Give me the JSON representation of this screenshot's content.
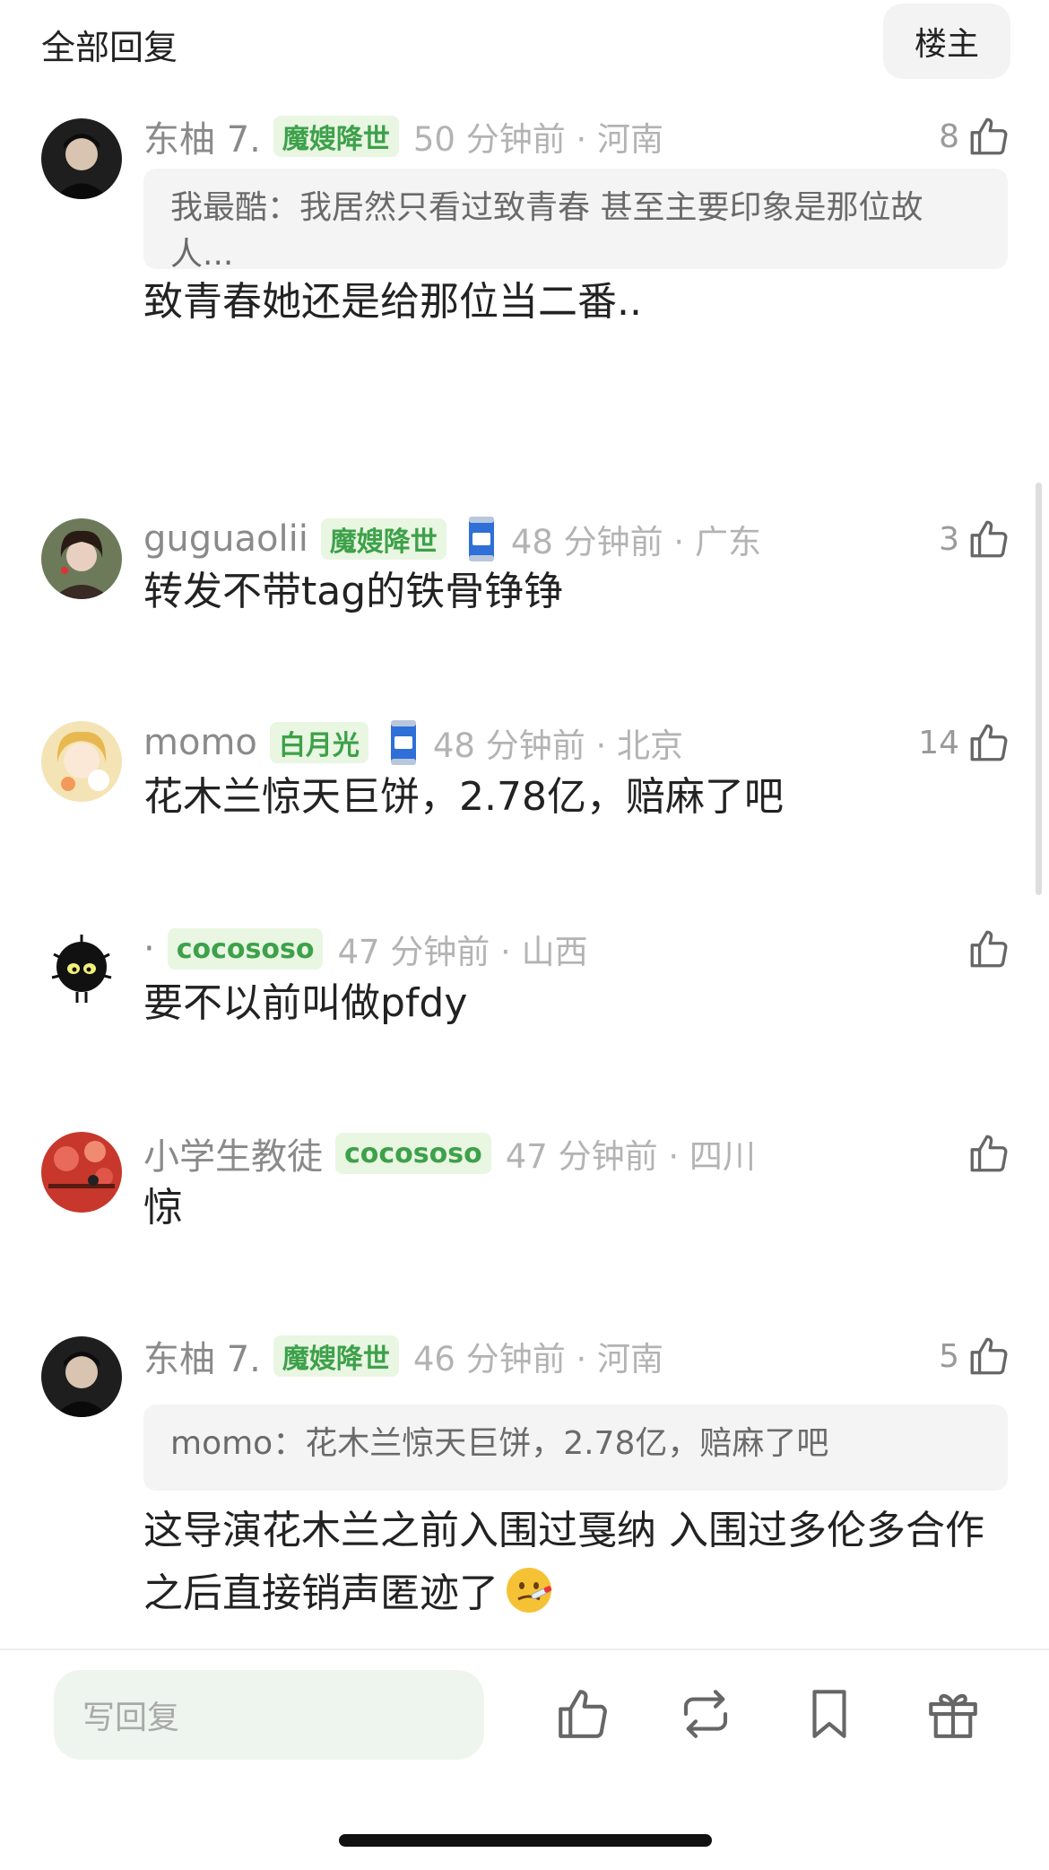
{
  "header": {
    "title": "全部回复",
    "op_button": "楼主"
  },
  "comments": [
    {
      "name": "东柚 7.",
      "badge": "魔嫂降世",
      "has_can": false,
      "time": "50 分钟前 · 河南",
      "likes": "8",
      "quote": "我最酷：我居然只看过致青春 甚至主要印象是那位故人...",
      "text": "致青春她还是给那位当二番.."
    },
    {
      "name": "guguaolii",
      "badge": "魔嫂降世",
      "has_can": true,
      "time": "48 分钟前 · 广东",
      "likes": "3",
      "quote": "",
      "text": "转发不带tag的铁骨铮铮"
    },
    {
      "name": "momo",
      "badge": "白月光",
      "has_can": true,
      "time": "48 分钟前 · 北京",
      "likes": "14",
      "quote": "",
      "text": "花木兰惊天巨饼，2.78亿，赔麻了吧"
    },
    {
      "name": "·",
      "badge": "cocososo",
      "has_can": false,
      "time": "47 分钟前 · 山西",
      "likes": "",
      "quote": "",
      "text": "要不以前叫做pfdy"
    },
    {
      "name": "小学生教徒",
      "badge": "cocososo",
      "has_can": false,
      "time": "47 分钟前 · 四川",
      "likes": "",
      "quote": "",
      "text": "惊"
    },
    {
      "name": "东柚 7.",
      "badge": "魔嫂降世",
      "has_can": false,
      "time": "46 分钟前 · 河南",
      "likes": "5",
      "quote": "momo：花木兰惊天巨饼，2.78亿，赔麻了吧",
      "text": "这导演花木兰之前入围过戛纳 入围过多伦多合作之后直接销声匿迹了"
    }
  ],
  "bottom_bar": {
    "reply_placeholder": "写回复"
  },
  "icons": {
    "like": "thumbs-up-icon",
    "repost": "repost-icon",
    "favorite": "bookmark-icon",
    "gift": "gift-icon",
    "badge_extra": "blue-can-icon",
    "emoji": "sick-face-emoji"
  },
  "colors": {
    "accent_green": "#3da14a",
    "badge_bg": "#e9f6e2",
    "meta_gray": "#8a8a8a"
  }
}
